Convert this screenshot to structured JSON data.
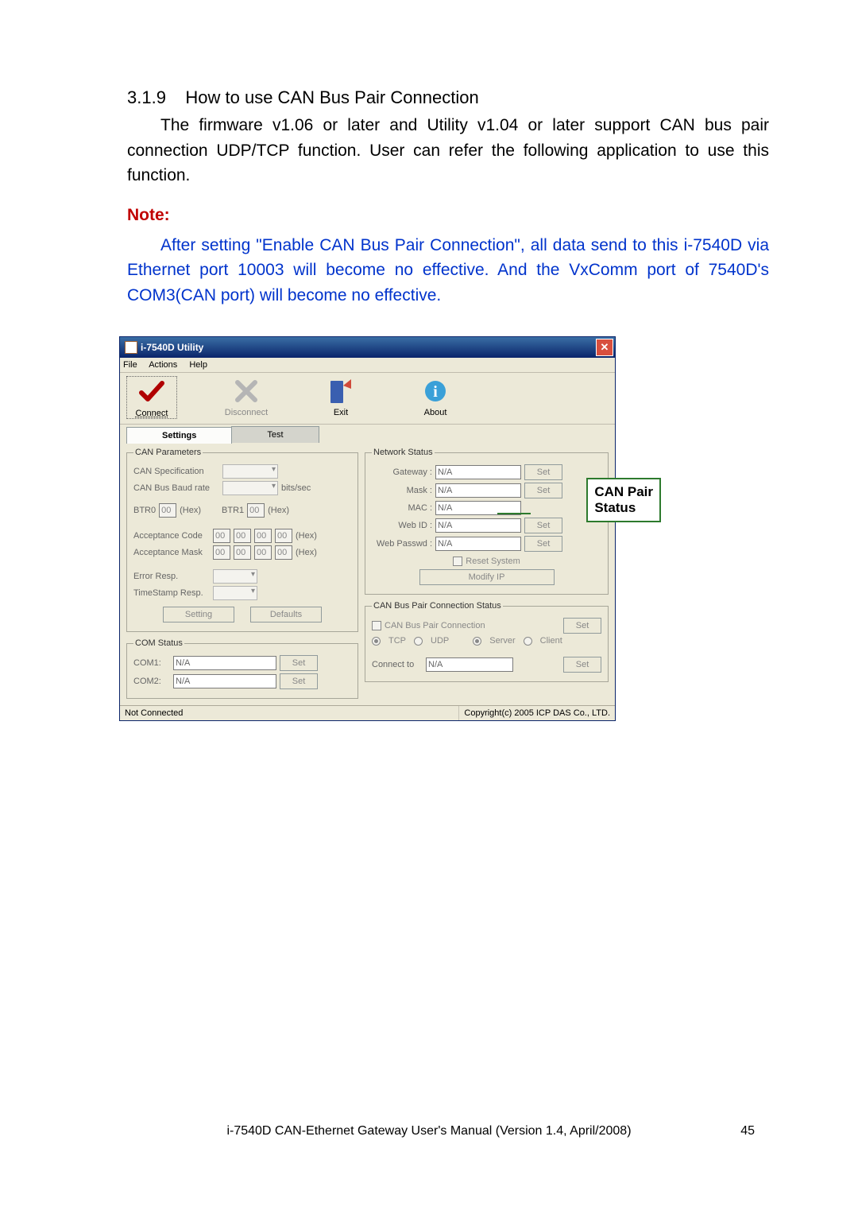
{
  "section": {
    "number": "3.1.9",
    "title": "How to use CAN Bus Pair Connection"
  },
  "paragraph": "The firmware v1.06 or later and Utility v1.04 or later support CAN bus pair connection UDP/TCP function. User can refer the following application to use this function.",
  "note_label": "Note:",
  "note_text": "After setting \"Enable CAN Bus Pair Connection\", all data send to this i-7540D via Ethernet port 10003 will become no effective. And the VxComm port of 7540D's COM3(CAN port) will become no effective.",
  "window": {
    "title": "i-7540D Utility",
    "menu": {
      "file": "File",
      "actions": "Actions",
      "help": "Help"
    },
    "toolbar": {
      "connect": "Connect",
      "disconnect": "Disconnect",
      "exit": "Exit",
      "about": "About"
    },
    "tabs": {
      "settings": "Settings",
      "test": "Test"
    },
    "can_params": {
      "legend": "CAN Parameters",
      "spec_label": "CAN Specification",
      "baud_label": "CAN Bus Baud rate",
      "baud_unit": "bits/sec",
      "btr0_label": "BTR0",
      "btr0_val": "00",
      "btr1_label": "BTR1",
      "btr1_val": "00",
      "hex": "(Hex)",
      "acc_code_label": "Acceptance Code",
      "acc_code": [
        "00",
        "00",
        "00",
        "00"
      ],
      "acc_mask_label": "Acceptance Mask",
      "acc_mask": [
        "00",
        "00",
        "00",
        "00"
      ],
      "error_resp_label": "Error Resp.",
      "ts_resp_label": "TimeStamp Resp.",
      "btn_setting": "Setting",
      "btn_defaults": "Defaults"
    },
    "com_status": {
      "legend": "COM Status",
      "com1_label": "COM1:",
      "com1_val": "N/A",
      "com2_label": "COM2:",
      "com2_val": "N/A",
      "btn_set": "Set"
    },
    "net_status": {
      "legend": "Network Status",
      "gateway_label": "Gateway :",
      "gateway_val": "N/A",
      "mask_label": "Mask :",
      "mask_val": "N/A",
      "mac_label": "MAC :",
      "mac_val": "N/A",
      "webid_label": "Web ID :",
      "webid_val": "N/A",
      "webpw_label": "Web Passwd :",
      "webpw_val": "N/A",
      "reset_label": "Reset System",
      "modify_btn": "Modify IP",
      "btn_set": "Set"
    },
    "pair": {
      "legend": "CAN Bus Pair Connection Status",
      "enable_label": "CAN Bus Pair Connection",
      "tcp": "TCP",
      "udp": "UDP",
      "server": "Server",
      "client": "Client",
      "connect_label": "Connect to",
      "connect_val": "N/A",
      "btn_set": "Set"
    },
    "statusbar": {
      "left": "Not Connected",
      "right": "Copyright(c) 2005 ICP DAS Co., LTD."
    }
  },
  "callout": {
    "line1": "CAN Pair",
    "line2": "Status"
  },
  "footer": {
    "text": "i-7540D CAN-Ethernet Gateway User's Manual (Version 1.4, April/2008)",
    "page": "45"
  }
}
